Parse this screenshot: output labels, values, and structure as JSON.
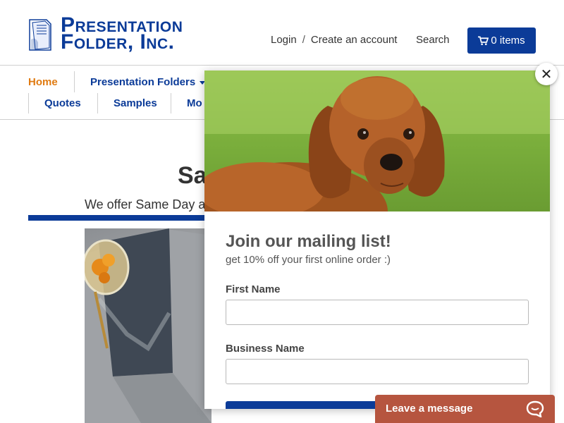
{
  "header": {
    "logo_line1": "Presentation",
    "logo_line2": "Folder, Inc.",
    "login": "Login",
    "separator": "/",
    "create_account": "Create an account",
    "search": "Search",
    "cart_label": "0 items"
  },
  "nav": {
    "row1": [
      {
        "label": "Home",
        "active": true
      },
      {
        "label": "Presentation Folders",
        "dropdown": true
      }
    ],
    "row2": [
      {
        "label": "Quotes"
      },
      {
        "label": "Samples"
      },
      {
        "label": "Mo"
      }
    ]
  },
  "main": {
    "title": "Sa",
    "subtitle": "We offer Same Day an"
  },
  "modal": {
    "heading": "Join our mailing list!",
    "subheading": "get 10% off your first online order :)",
    "first_name_label": "First Name",
    "business_name_label": "Business Name",
    "close_glyph": "✕"
  },
  "chat": {
    "label": "Leave a message"
  },
  "colors": {
    "brand_blue": "#0b3b98",
    "active_orange": "#e07b12",
    "chat_bg": "#b6553f"
  },
  "icons": [
    "logo-folder-icon",
    "cart-icon",
    "caret-down-icon",
    "close-icon",
    "chat-bubble-icon"
  ]
}
